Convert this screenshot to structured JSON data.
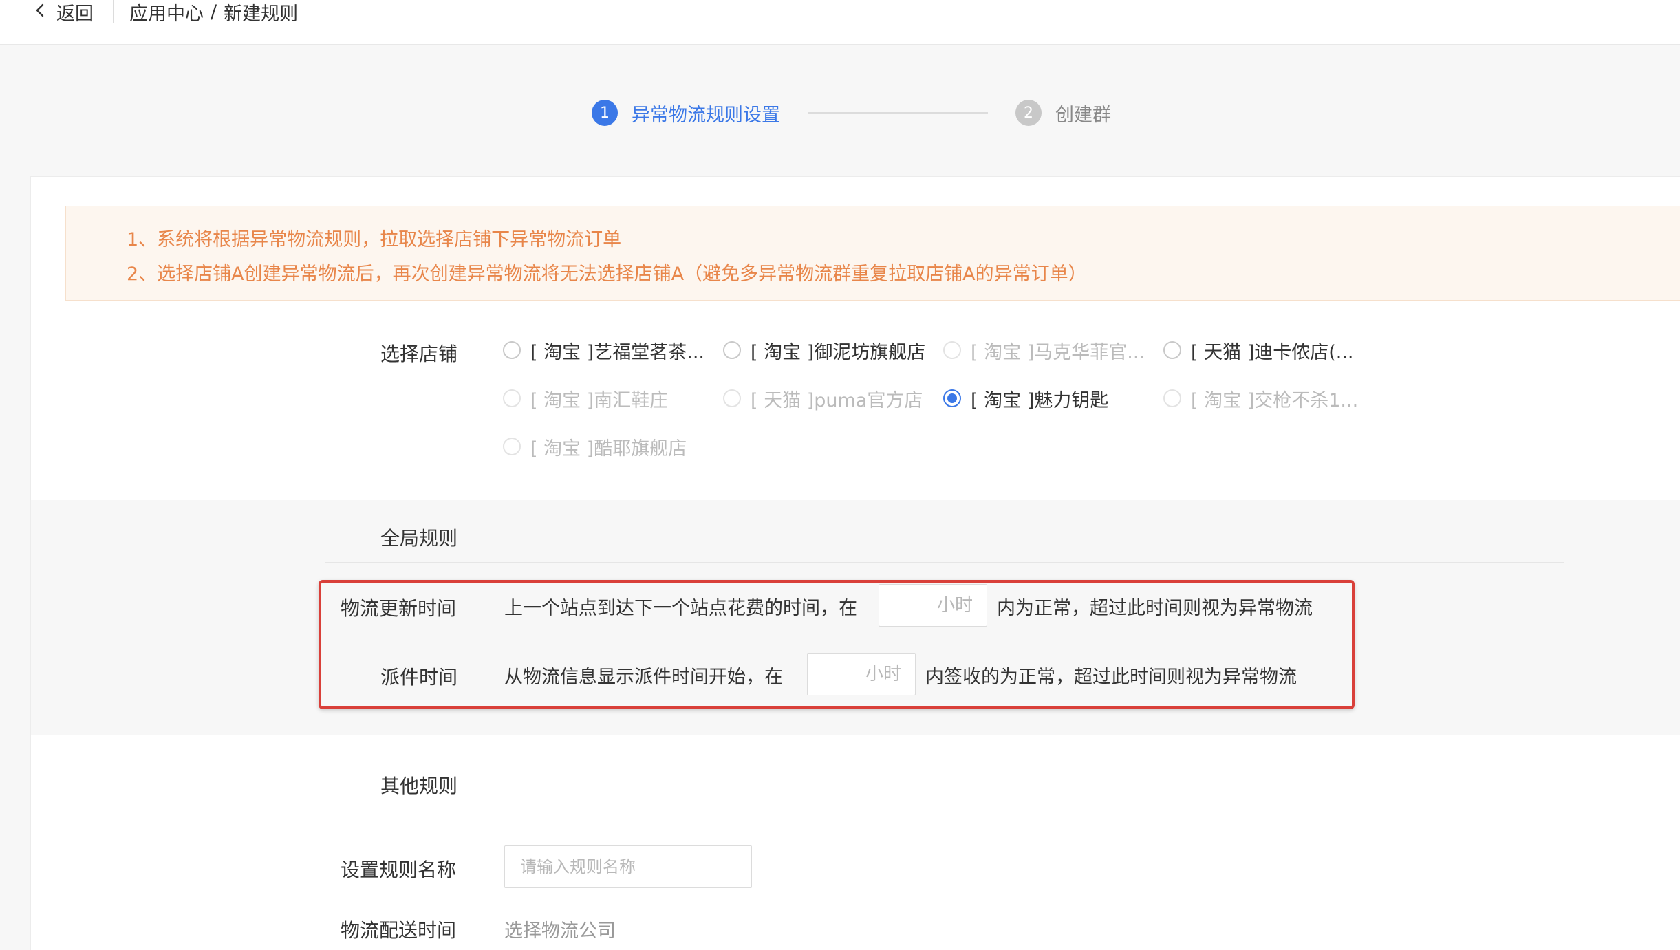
{
  "topbar": {
    "back_label": "返回",
    "breadcrumb_parent": "应用中心",
    "breadcrumb_sep": "/",
    "breadcrumb_current": "新建规则"
  },
  "steps": [
    {
      "num": "1",
      "label": "异常物流规则设置",
      "state": "active"
    },
    {
      "num": "2",
      "label": "创建群",
      "state": "inactive"
    }
  ],
  "notice": {
    "line1": "1、系统将根据异常物流规则，拉取选择店铺下异常物流订单",
    "line2": "2、选择店铺A创建异常物流后，再次创建异常物流将无法选择店铺A（避免多异常物流群重复拉取店铺A的异常订单）"
  },
  "store_section": {
    "label": "选择店铺",
    "stores": [
      {
        "text": "[ 淘宝 ]艺福堂茗茶...",
        "state": "enabled"
      },
      {
        "text": "[ 淘宝 ]御泥坊旗舰店",
        "state": "enabled"
      },
      {
        "text": "[ 淘宝 ]马克华菲官...",
        "state": "disabled"
      },
      {
        "text": "[ 天猫 ]迪卡侬店(...",
        "state": "enabled"
      },
      {
        "text": "[ 淘宝 ]南汇鞋庄",
        "state": "disabled"
      },
      {
        "text": "[ 天猫 ]puma官方店",
        "state": "disabled"
      },
      {
        "text": "[ 淘宝 ]魅力钥匙",
        "state": "checked"
      },
      {
        "text": "[ 淘宝 ]交枪不杀1...",
        "state": "disabled"
      },
      {
        "text": "[ 淘宝 ]酷耶旗舰店",
        "state": "disabled"
      }
    ]
  },
  "global_rules": {
    "title": "全局规则",
    "update_time": {
      "label": "物流更新时间",
      "prefix": "上一个站点到达下一个站点花费的时间，在",
      "placeholder": "小时",
      "suffix": "内为正常，超过此时间则视为异常物流"
    },
    "dispatch_time": {
      "label": "派件时间",
      "prefix": "从物流信息显示派件时间开始，在",
      "placeholder": "小时",
      "suffix": "内签收的为正常，超过此时间则视为异常物流"
    }
  },
  "other_rules": {
    "title": "其他规则",
    "rule_name_label": "设置规则名称",
    "rule_name_placeholder": "请输入规则名称",
    "delivery_label": "物流配送时间",
    "delivery_select": "选择物流公司"
  },
  "colors": {
    "primary": "#3b78e7",
    "notice_text": "#e8864a",
    "highlight_border": "#d9403a"
  }
}
